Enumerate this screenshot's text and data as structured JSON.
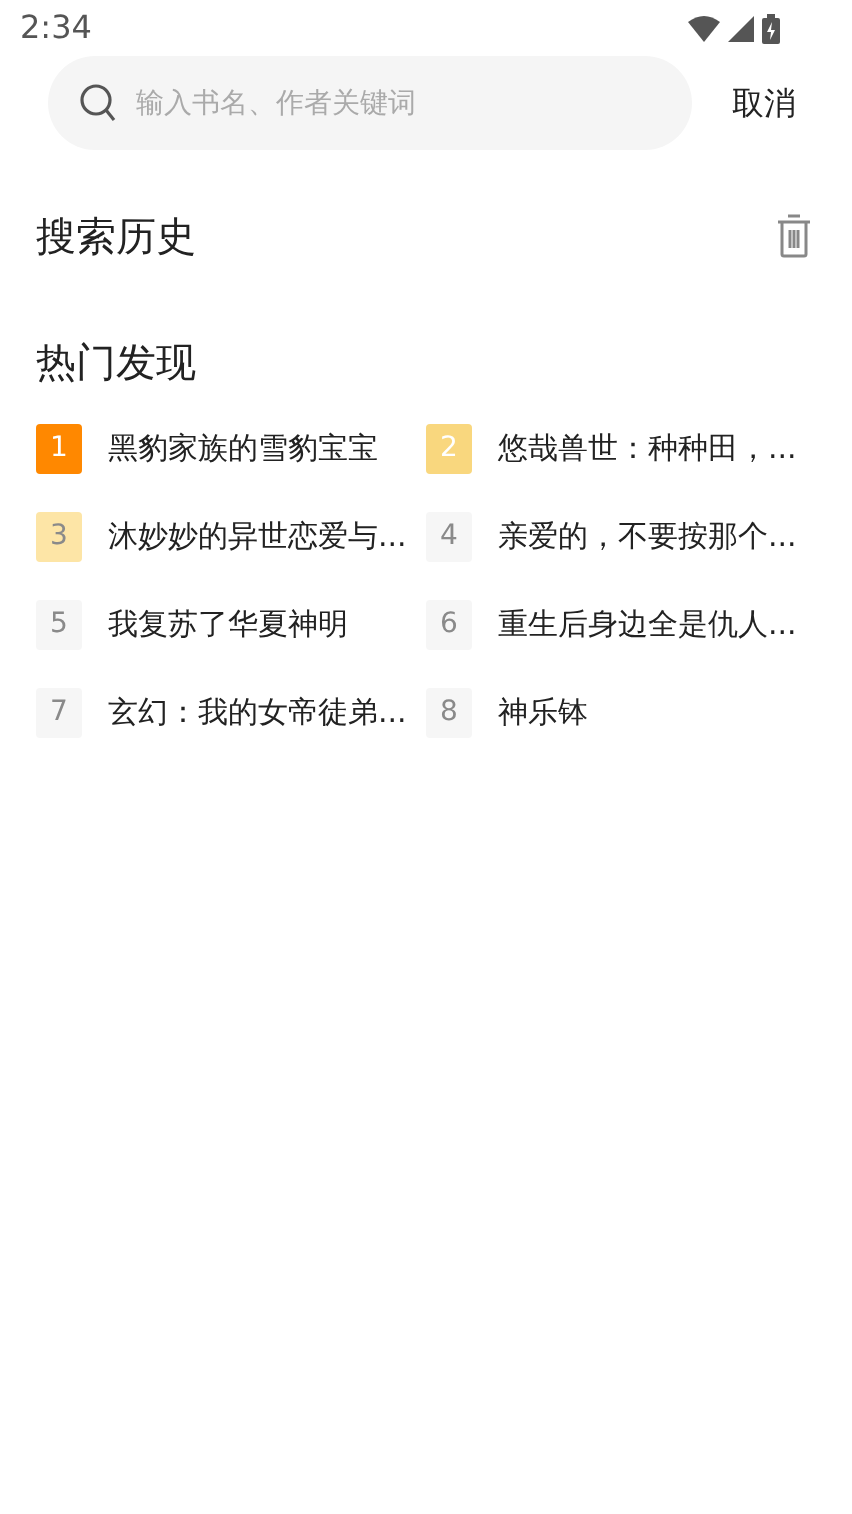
{
  "status_bar": {
    "time": "2:34"
  },
  "search": {
    "placeholder": "输入书名、作者关键词",
    "cancel": "取消"
  },
  "history": {
    "title": "搜索历史"
  },
  "hot": {
    "title": "热门发现",
    "items": [
      {
        "rank": "1",
        "title": "黑豹家族的雪豹宝宝",
        "color": "#ff8800"
      },
      {
        "rank": "2",
        "title": "悠哉兽世：种种田，...",
        "color": "#f9d77e"
      },
      {
        "rank": "3",
        "title": "沐妙妙的异世恋爱与...",
        "color": "#fde5a6"
      },
      {
        "rank": "4",
        "title": "亲爱的，不要按那个...",
        "color": "#f6f6f6"
      },
      {
        "rank": "5",
        "title": "我复苏了华夏神明",
        "color": "#f6f6f6"
      },
      {
        "rank": "6",
        "title": "重生后身边全是仇人...",
        "color": "#f6f6f6"
      },
      {
        "rank": "7",
        "title": "玄幻：我的女帝徒弟...",
        "color": "#f6f6f6"
      },
      {
        "rank": "8",
        "title": "神乐钵",
        "color": "#f6f6f6"
      }
    ]
  }
}
